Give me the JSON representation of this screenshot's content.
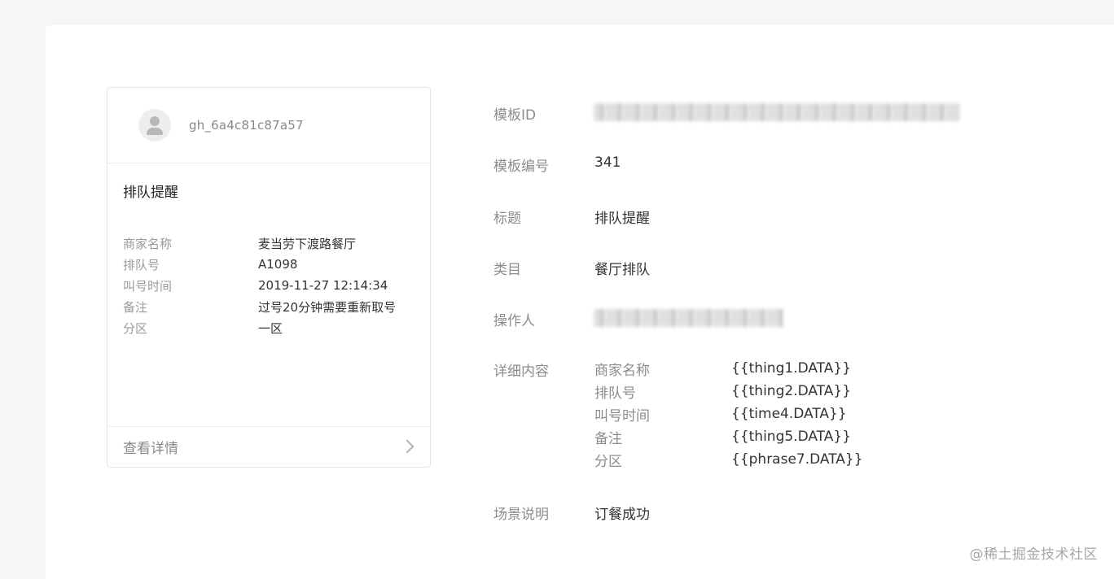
{
  "preview": {
    "account_name": "gh_6a4c81c87a57",
    "title": "排队提醒",
    "fields": [
      {
        "key": "商家名称",
        "value": "麦当劳下渡路餐厅"
      },
      {
        "key": "排队号",
        "value": "A1098"
      },
      {
        "key": "叫号时间",
        "value": "2019-11-27 12:14:34"
      },
      {
        "key": "备注",
        "value": "过号20分钟需要重新取号"
      },
      {
        "key": "分区",
        "value": "一区"
      }
    ],
    "footer_label": "查看详情"
  },
  "details": {
    "template_id_label": "模板ID",
    "template_no_label": "模板编号",
    "template_no": "341",
    "title_label": "标题",
    "title": "排队提醒",
    "category_label": "类目",
    "category": "餐厅排队",
    "operator_label": "操作人",
    "content_label": "详细内容",
    "content_fields": [
      {
        "key": "商家名称",
        "value": "{{thing1.DATA}}"
      },
      {
        "key": "排队号",
        "value": "{{thing2.DATA}}"
      },
      {
        "key": "叫号时间",
        "value": "{{time4.DATA}}"
      },
      {
        "key": "备注",
        "value": "{{thing5.DATA}}"
      },
      {
        "key": "分区",
        "value": "{{phrase7.DATA}}"
      }
    ],
    "scene_label": "场景说明",
    "scene": "订餐成功"
  },
  "watermark": "@稀土掘金技术社区"
}
